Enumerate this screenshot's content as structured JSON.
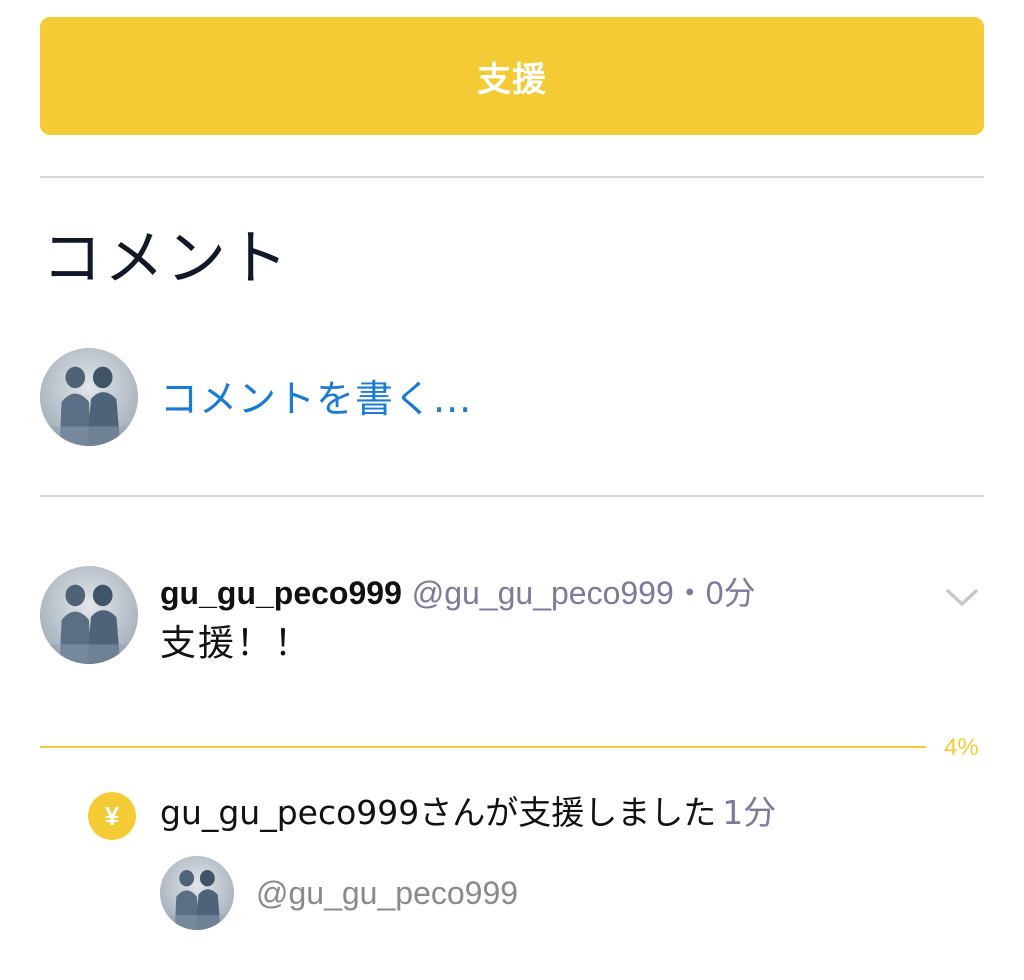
{
  "support_button": {
    "label": "支援"
  },
  "comments_section": {
    "title": "コメント",
    "write_placeholder": "コメントを書く..."
  },
  "comment": {
    "username": "gu_gu_peco999",
    "handle": "@gu_gu_peco999",
    "separator": "・",
    "time": "0分",
    "body": "支援！！"
  },
  "support_progress": {
    "percent_label": "4%",
    "value_percent": 4
  },
  "support_activity": {
    "icon": "yen-icon",
    "icon_glyph": "¥",
    "text": "gu_gu_peco999さんが支援しました",
    "time": "1分",
    "supporter_handle": "@gu_gu_peco999"
  },
  "colors": {
    "accent": "#f5cb35",
    "link": "#1a7bd6",
    "muted": "#7d7a9c",
    "divider": "#d6d6d6"
  }
}
